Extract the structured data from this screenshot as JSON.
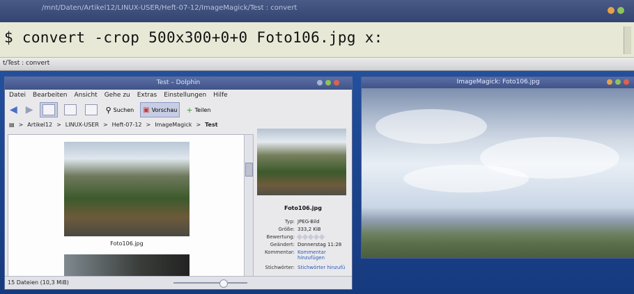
{
  "terminal": {
    "title": "/mnt/Daten/Artikel12/LINUX-USER/Heft-07-12/ImageMagick/Test : convert",
    "command": "$ convert -crop 500x300+0+0 Foto106.jpg x:",
    "tab_label": "t/Test : convert"
  },
  "dolphin": {
    "title": "Test – Dolphin",
    "menu": [
      "Datei",
      "Bearbeiten",
      "Ansicht",
      "Gehe zu",
      "Extras",
      "Einstellungen",
      "Hilfe"
    ],
    "toolbar": {
      "search": "Suchen",
      "preview": "Vorschau",
      "split": "Teilen"
    },
    "breadcrumb": [
      "Artikel12",
      "LINUX-USER",
      "Heft-07-12",
      "ImageMagick",
      "Test"
    ],
    "files": [
      {
        "name": "Foto106.jpg"
      }
    ],
    "info": {
      "filename": "Foto106.jpg",
      "type_label": "Typ:",
      "type_value": "JPEG-Bild",
      "size_label": "Größe:",
      "size_value": "333,2 KiB",
      "rating_label": "Bewertung:",
      "changed_label": "Geändert:",
      "changed_value": "Donnerstag 11:28",
      "comment_label": "Kommentar:",
      "comment_value": "Kommentar hinzufügen",
      "tags_label": "Stichwörter:",
      "tags_value": "Stichwörter hinzufü"
    },
    "status": "15 Dateien (10,3 MiB)"
  },
  "imagemagick": {
    "title": "ImageMagick: Foto106.jpg"
  },
  "colors": {
    "titlebar": "#3f5388",
    "link": "#2a58b8",
    "terminal_bg": "#e7e9d6"
  }
}
